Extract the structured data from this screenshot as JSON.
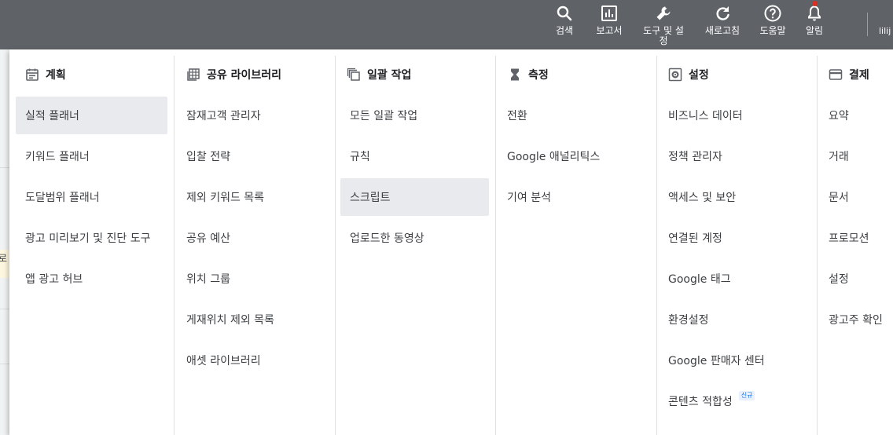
{
  "header": {
    "buttons": [
      {
        "label": "검색",
        "icon": "search-icon"
      },
      {
        "label": "보고서",
        "icon": "bar-chart-icon"
      },
      {
        "label_line1": "도구 및 설",
        "label_line2": "정",
        "icon": "wrench-icon"
      },
      {
        "label": "새로고침",
        "icon": "refresh-icon"
      },
      {
        "label": "도움말",
        "icon": "help-icon"
      },
      {
        "label": "알림",
        "icon": "bell-icon"
      }
    ],
    "user": "lilij"
  },
  "background": {
    "clipped_text": "로"
  },
  "menu": {
    "columns": [
      {
        "title": "계획",
        "icon": "calendar-icon",
        "items": [
          "실적 플래너",
          "키워드 플래너",
          "도달범위 플래너",
          "광고 미리보기 및 진단 도구",
          "앱 광고 허브"
        ]
      },
      {
        "title": "공유 라이브러리",
        "icon": "library-grid-icon",
        "items": [
          "잠재고객 관리자",
          "입찰 전략",
          "제외 키워드 목록",
          "공유 예산",
          "위치 그룹",
          "게재위치 제외 목록",
          "애셋 라이브러리"
        ]
      },
      {
        "title": "일괄 작업",
        "icon": "copy-stack-icon",
        "items": [
          "모든 일괄 작업",
          "규칙",
          "스크립트",
          "업로드한 동영상"
        ]
      },
      {
        "title": "측정",
        "icon": "hourglass-icon",
        "items": [
          "전환",
          "Google 애널리틱스",
          "기여 분석"
        ]
      },
      {
        "title": "설정",
        "icon": "settings-box-icon",
        "items": [
          "비즈니스 데이터",
          "정책 관리자",
          "액세스 및 보안",
          "연결된 계정",
          "Google 태그",
          "환경설정",
          "Google 판매자 센터",
          "콘텐츠 적합성"
        ],
        "badge": "신규"
      },
      {
        "title": "결제",
        "icon": "credit-card-icon",
        "items": [
          "요약",
          "거래",
          "문서",
          "프로모션",
          "설정",
          "광고주 확인"
        ]
      }
    ],
    "active_items": [
      "실적 플래너",
      "스크립트"
    ]
  },
  "colors": {
    "header_bg": "#5f6368",
    "active_item_bg": "#e8eaed",
    "notification_dot": "#d93025",
    "badge_text": "#1a73e8"
  }
}
